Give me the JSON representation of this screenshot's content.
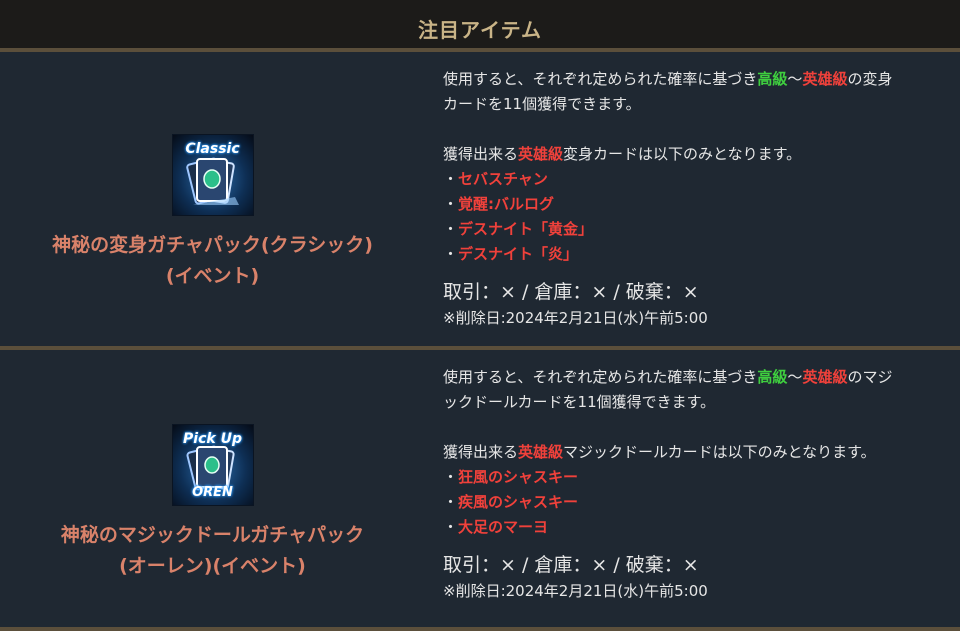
{
  "header": {
    "title": "注目アイテム"
  },
  "items": [
    {
      "icon_top": "Classic",
      "icon_bottom": "",
      "name_line1": "神秘の変身ガチャパック(クラシック)",
      "name_line2": "(イベント)",
      "desc_a": "使用すると、それぞれ定められた確率に基づき",
      "grade_low": "高級",
      "tilde": "〜",
      "grade_high": "英雄級",
      "desc_b": "の変身",
      "desc_line2": "カードを11個獲得できます。",
      "avail_prefix": "獲得出来る",
      "avail_grade": "英雄級",
      "avail_suffix": "変身カードは以下のみとなります。",
      "bullet": "・",
      "cards": [
        "セバスチャン",
        "覚醒:バルログ",
        "デスナイト「黄金」",
        "デスナイト「炎」"
      ],
      "trade": "取引：× / 倉庫：× / 破棄：×",
      "delete_date": "※削除日:2024年2月21日(水)午前5:00"
    },
    {
      "icon_top": "Pick Up",
      "icon_bottom": "OREN",
      "name_line1": "神秘のマジックドールガチャパック",
      "name_line2": "(オーレン)(イベント)",
      "desc_a": "使用すると、それぞれ定められた確率に基づき",
      "grade_low": "高級",
      "tilde": "〜",
      "grade_high": "英雄級",
      "desc_b": "のマジ",
      "desc_line2": "ックドールカードを11個獲得できます。",
      "avail_prefix": "獲得出来る",
      "avail_grade": "英雄級",
      "avail_suffix": "マジックドールカードは以下のみとなります。",
      "bullet": "・",
      "cards": [
        "狂風のシャスキー",
        "疾風のシャスキー",
        "大足のマーヨ"
      ],
      "trade": "取引：× / 倉庫：× / 破棄：×",
      "delete_date": "※削除日:2024年2月21日(水)午前5:00"
    }
  ],
  "colors": {
    "grade_low": "#3fcf3f",
    "grade_high": "#f0413b",
    "item_name": "#d9826a",
    "header_text": "#c9b487"
  },
  "icons": [
    "gacha-pack-classic-icon",
    "gacha-pack-oren-icon"
  ]
}
